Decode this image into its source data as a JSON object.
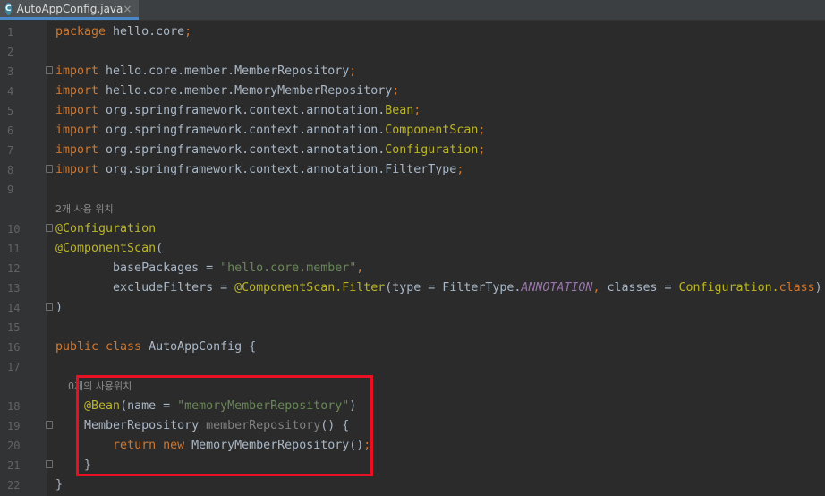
{
  "tab": {
    "icon": "C",
    "label": "AutoAppConfig.java",
    "close": "×"
  },
  "lines": [
    {
      "n": "1",
      "parts": [
        {
          "t": "package ",
          "c": "kw"
        },
        {
          "t": "hello.core",
          "c": ""
        },
        {
          "t": ";",
          "c": "kw"
        }
      ]
    },
    {
      "n": "2",
      "parts": []
    },
    {
      "n": "3",
      "parts": [
        {
          "t": "import ",
          "c": "kw"
        },
        {
          "t": "hello.core.member.MemberRepository",
          "c": ""
        },
        {
          "t": ";",
          "c": "kw"
        }
      ]
    },
    {
      "n": "4",
      "parts": [
        {
          "t": "import ",
          "c": "kw"
        },
        {
          "t": "hello.core.member.MemoryMemberRepository",
          "c": ""
        },
        {
          "t": ";",
          "c": "kw"
        }
      ]
    },
    {
      "n": "5",
      "parts": [
        {
          "t": "import ",
          "c": "kw"
        },
        {
          "t": "org.springframework.context.annotation.",
          "c": ""
        },
        {
          "t": "Bean",
          "c": "cls"
        },
        {
          "t": ";",
          "c": "kw"
        }
      ]
    },
    {
      "n": "6",
      "parts": [
        {
          "t": "import ",
          "c": "kw"
        },
        {
          "t": "org.springframework.context.annotation.",
          "c": ""
        },
        {
          "t": "ComponentScan",
          "c": "cls"
        },
        {
          "t": ";",
          "c": "kw"
        }
      ]
    },
    {
      "n": "7",
      "parts": [
        {
          "t": "import ",
          "c": "kw"
        },
        {
          "t": "org.springframework.context.annotation.",
          "c": ""
        },
        {
          "t": "Configuration",
          "c": "cls"
        },
        {
          "t": ";",
          "c": "kw"
        }
      ]
    },
    {
      "n": "8",
      "parts": [
        {
          "t": "import ",
          "c": "kw"
        },
        {
          "t": "org.springframework.context.annotation.FilterType",
          "c": ""
        },
        {
          "t": ";",
          "c": "kw"
        }
      ]
    },
    {
      "n": "9",
      "parts": []
    },
    {
      "n": "",
      "hint": "2개 사용 위치"
    },
    {
      "n": "10",
      "parts": [
        {
          "t": "@Configuration",
          "c": "ann"
        }
      ]
    },
    {
      "n": "11",
      "parts": [
        {
          "t": "@ComponentScan",
          "c": "ann"
        },
        {
          "t": "(",
          "c": ""
        }
      ]
    },
    {
      "n": "12",
      "parts": [
        {
          "t": "        basePackages = ",
          "c": ""
        },
        {
          "t": "\"hello.core.member\"",
          "c": "str"
        },
        {
          "t": ",",
          "c": "kw"
        }
      ]
    },
    {
      "n": "13",
      "parts": [
        {
          "t": "        excludeFilters = ",
          "c": ""
        },
        {
          "t": "@ComponentScan.Filter",
          "c": "ann"
        },
        {
          "t": "(type = FilterType.",
          "c": ""
        },
        {
          "t": "ANNOTATION",
          "c": "stat"
        },
        {
          "t": ", ",
          "c": "kw"
        },
        {
          "t": "classes = ",
          "c": ""
        },
        {
          "t": "Configuration.",
          "c": "cls"
        },
        {
          "t": "class",
          "c": "kw"
        },
        {
          "t": ")",
          "c": ""
        }
      ]
    },
    {
      "n": "14",
      "parts": [
        {
          "t": ")",
          "c": ""
        }
      ]
    },
    {
      "n": "15",
      "parts": []
    },
    {
      "n": "16",
      "parts": [
        {
          "t": "public class ",
          "c": "kw"
        },
        {
          "t": "AutoAppConfig {",
          "c": ""
        }
      ]
    },
    {
      "n": "17",
      "parts": []
    },
    {
      "n": "",
      "hint": "    0개의 사용위치"
    },
    {
      "n": "18",
      "parts": [
        {
          "t": "    ",
          "c": ""
        },
        {
          "t": "@Bean",
          "c": "ann"
        },
        {
          "t": "(name = ",
          "c": ""
        },
        {
          "t": "\"memoryMemberRepository\"",
          "c": "str"
        },
        {
          "t": ")",
          "c": ""
        }
      ]
    },
    {
      "n": "19",
      "parts": [
        {
          "t": "    MemberRepository ",
          "c": ""
        },
        {
          "t": "memberRepository",
          "c": "gray"
        },
        {
          "t": "() {",
          "c": ""
        }
      ]
    },
    {
      "n": "20",
      "parts": [
        {
          "t": "        ",
          "c": ""
        },
        {
          "t": "return new ",
          "c": "kw"
        },
        {
          "t": "MemoryMemberRepository()",
          "c": ""
        },
        {
          "t": ";",
          "c": "kw"
        }
      ]
    },
    {
      "n": "21",
      "parts": [
        {
          "t": "    }",
          "c": ""
        }
      ]
    },
    {
      "n": "22",
      "parts": [
        {
          "t": "}",
          "c": ""
        }
      ]
    }
  ]
}
